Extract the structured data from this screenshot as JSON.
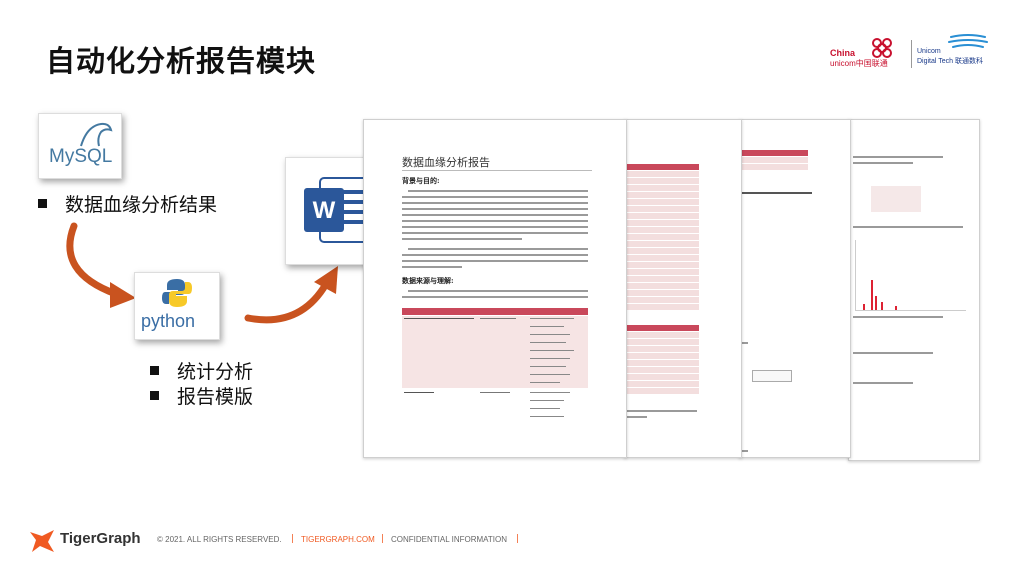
{
  "slide": {
    "title": "自动化分析报告模块"
  },
  "logos": {
    "china_unicom_line1": "China",
    "china_unicom_line2": "unicom中国联通",
    "digital_tech_line1": "Unicom",
    "digital_tech_line2": "Digital Tech 联通数科"
  },
  "sources": {
    "mysql_label": "MySQL",
    "python_label": "python"
  },
  "bullets": {
    "lineage_result": "数据血缘分析结果",
    "stats_analysis": "统计分析",
    "report_template": "报告模版"
  },
  "document": {
    "title": "数据血缘分析报告",
    "section1": "背景与目的:",
    "section2": "数据来源与理解:"
  },
  "footer": {
    "brand": "TigerGraph",
    "copyright": "© 2021. ALL RIGHTS RESERVED.",
    "site": "TIGERGRAPH.COM",
    "confidential": "CONFIDENTIAL INFORMATION"
  },
  "colors": {
    "accent_orange": "#f05a22",
    "table_red": "#c9485b",
    "unicom_red": "#c8102e"
  },
  "icons": [
    "mysql-logo-icon",
    "python-logo-icon",
    "word-icon",
    "curved-arrow-icon",
    "tigergraph-logo-icon"
  ]
}
